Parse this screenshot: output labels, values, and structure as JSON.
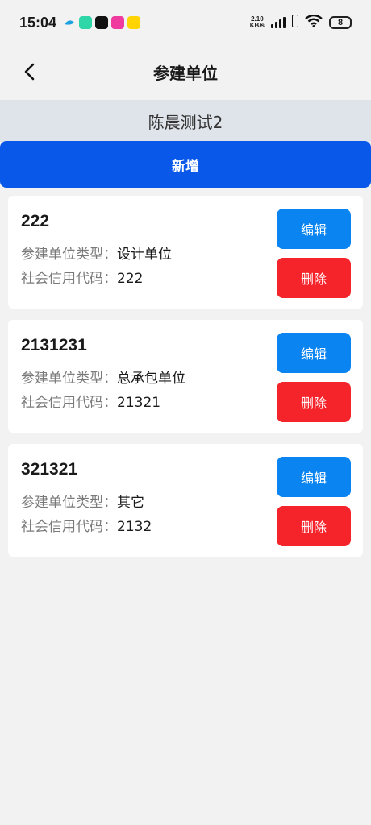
{
  "status": {
    "time": "15:04",
    "net_speed_value": "2.10",
    "net_speed_unit": "KB/s",
    "battery": "8"
  },
  "nav": {
    "title": "参建单位"
  },
  "subheader": "陈晨测试2",
  "add_button_label": "新增",
  "labels": {
    "type": "参建单位类型：",
    "credit": "社会信用代码："
  },
  "buttons": {
    "edit": "编辑",
    "delete": "删除"
  },
  "units": [
    {
      "name": "222",
      "type": "设计单位",
      "credit_code": "222"
    },
    {
      "name": "2131231",
      "type": "总承包单位",
      "credit_code": "21321"
    },
    {
      "name": "321321",
      "type": "其它",
      "credit_code": "2132"
    }
  ],
  "colors": {
    "primary": "#0a58ea",
    "edit": "#0a84f0",
    "delete": "#f5232a",
    "subheader_bg": "#dfe4ea"
  }
}
